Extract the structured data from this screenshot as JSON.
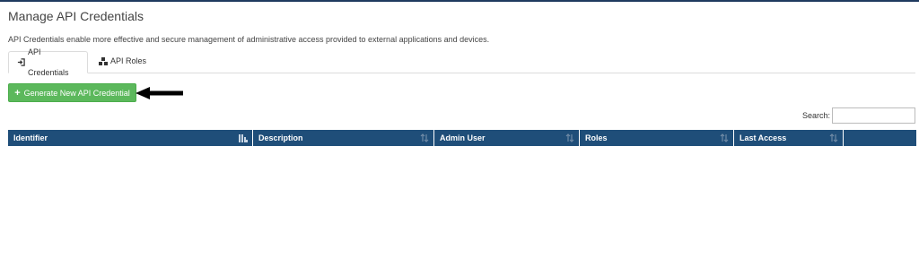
{
  "page": {
    "title": "Manage API Credentials",
    "description": "API Credentials enable more effective and secure management of administrative access provided to external applications and devices."
  },
  "tabs": [
    {
      "label": "API Credentials",
      "icon": "sign-in-icon",
      "active": true
    },
    {
      "label": "API Roles",
      "icon": "cubes-icon",
      "active": false
    }
  ],
  "actions": {
    "generate_label": "Generate New API Credential",
    "generate_icon": "plus-icon",
    "annotation": "arrow-left-icon"
  },
  "search": {
    "label": "Search:",
    "value": "",
    "placeholder": ""
  },
  "table": {
    "columns": [
      {
        "label": "Identifier",
        "sort": "ascending"
      },
      {
        "label": "Description",
        "sort": "none"
      },
      {
        "label": "Admin User",
        "sort": "none"
      },
      {
        "label": "Roles",
        "sort": "none"
      },
      {
        "label": "Last Access",
        "sort": "none"
      },
      {
        "label": "",
        "sort": "disabled"
      }
    ],
    "rows": []
  },
  "colors": {
    "header_bg": "#1f4e79",
    "button_green": "#5cb85c",
    "top_border": "#1f3a5f"
  }
}
